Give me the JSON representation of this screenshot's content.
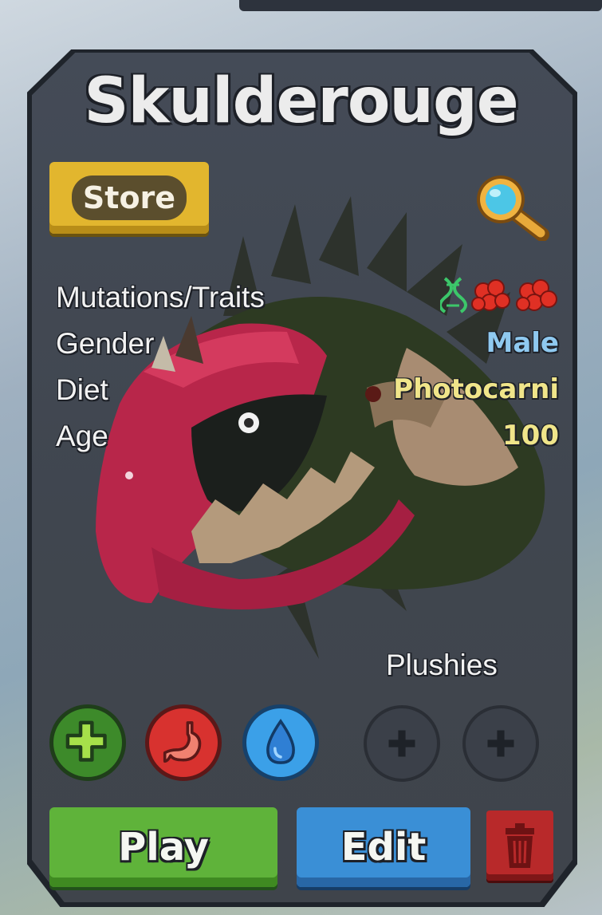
{
  "creature": {
    "name": "Skulderouge",
    "gender": "Male",
    "diet": "Photocarni",
    "age": "100"
  },
  "labels": {
    "mutations_traits": "Mutations/Traits",
    "gender": "Gender",
    "diet": "Diet",
    "age": "Age",
    "plushies": "Plushies"
  },
  "buttons": {
    "store": "Store",
    "play": "Play",
    "edit": "Edit"
  },
  "icons": {
    "inspect": "magnifying-glass-icon",
    "dna": "dna-icon",
    "trait_1": "red-cluster-icon",
    "trait_2": "red-cluster-icon",
    "health": "plus-icon",
    "hunger": "stomach-icon",
    "thirst": "water-drop-icon",
    "plush_slot": "plus-icon",
    "delete": "trash-icon"
  },
  "colors": {
    "gender": "#8fc9f0",
    "diet": "#f0e58a",
    "age": "#f0e58a",
    "store": "#e2b62e",
    "play": "#5fb33a",
    "edit": "#3a8fd6",
    "delete": "#b8292a"
  }
}
